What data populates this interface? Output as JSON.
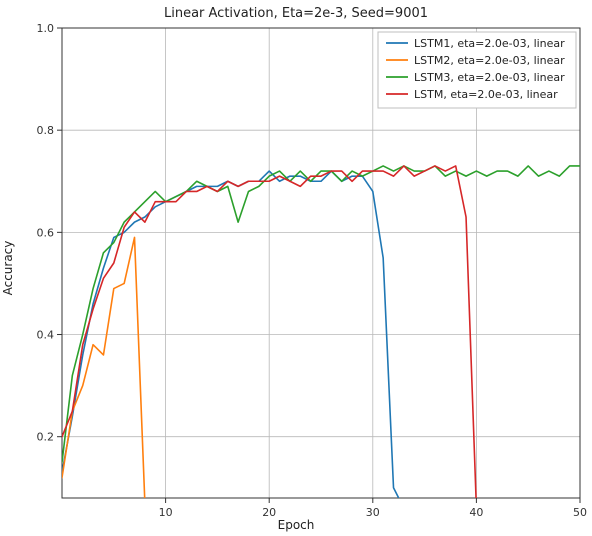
{
  "chart_data": {
    "type": "line",
    "title": "Linear Activation, Eta=2e-3, Seed=9001",
    "xlabel": "Epoch",
    "ylabel": "Accuracy",
    "xlim": [
      0,
      50
    ],
    "ylim": [
      0.08,
      1.0
    ],
    "xticks": [
      10,
      20,
      30,
      40,
      50
    ],
    "yticks": [
      0.2,
      0.4,
      0.6,
      0.8,
      1.0
    ],
    "grid": true,
    "legend_position": "upper-right",
    "x": [
      0,
      1,
      2,
      3,
      4,
      5,
      6,
      7,
      8,
      9,
      10,
      11,
      12,
      13,
      14,
      15,
      16,
      17,
      18,
      19,
      20,
      21,
      22,
      23,
      24,
      25,
      26,
      27,
      28,
      29,
      30,
      31,
      32,
      33,
      34,
      35,
      36,
      37,
      38,
      39,
      40,
      41,
      42,
      43,
      44,
      45,
      46,
      47,
      48,
      49,
      50
    ],
    "series": [
      {
        "name": "LSTM1, eta=2.0e-03, linear",
        "color": "#1f77b4",
        "values": [
          0.13,
          0.24,
          0.36,
          0.46,
          0.53,
          0.59,
          0.6,
          0.62,
          0.63,
          0.65,
          0.66,
          0.67,
          0.68,
          0.69,
          0.69,
          0.69,
          0.7,
          0.69,
          0.7,
          0.7,
          0.72,
          0.7,
          0.71,
          0.71,
          0.7,
          0.7,
          0.72,
          0.7,
          0.71,
          0.71,
          0.68,
          0.55,
          0.1,
          0.06,
          0.05,
          0.04,
          0.03,
          0.03,
          0.03,
          0.03,
          0.03,
          0.03,
          0.03,
          0.03,
          0.03,
          0.03,
          0.03,
          0.03,
          0.03,
          0.03,
          0.03
        ]
      },
      {
        "name": "LSTM2, eta=2.0e-03, linear",
        "color": "#ff7f0e",
        "values": [
          0.12,
          0.25,
          0.3,
          0.38,
          0.36,
          0.49,
          0.5,
          0.59,
          0.07,
          0.04,
          0.07,
          0.06,
          0.05,
          0.05,
          0.04,
          0.04,
          0.04,
          0.04,
          0.05,
          0.04,
          0.04,
          0.04,
          0.05,
          0.04,
          0.04,
          0.03,
          0.04,
          0.03,
          0.04,
          0.03,
          0.03,
          0.03,
          0.03,
          0.03,
          0.03,
          0.03,
          0.03,
          0.03,
          0.03,
          0.03,
          0.03,
          0.03,
          0.03,
          0.03,
          0.03,
          0.03,
          0.03,
          0.03,
          0.03,
          0.03,
          0.03
        ]
      },
      {
        "name": "LSTM3, eta=2.0e-03, linear",
        "color": "#2ca02c",
        "values": [
          0.15,
          0.32,
          0.4,
          0.49,
          0.56,
          0.58,
          0.62,
          0.64,
          0.66,
          0.68,
          0.66,
          0.67,
          0.68,
          0.7,
          0.69,
          0.68,
          0.69,
          0.62,
          0.68,
          0.69,
          0.71,
          0.72,
          0.7,
          0.72,
          0.7,
          0.72,
          0.72,
          0.7,
          0.72,
          0.71,
          0.72,
          0.73,
          0.72,
          0.73,
          0.72,
          0.72,
          0.73,
          0.71,
          0.72,
          0.71,
          0.72,
          0.71,
          0.72,
          0.72,
          0.71,
          0.73,
          0.71,
          0.72,
          0.71,
          0.73,
          0.73
        ]
      },
      {
        "name": "LSTM, eta=2.0e-03, linear",
        "color": "#d62728",
        "values": [
          0.2,
          0.25,
          0.38,
          0.45,
          0.51,
          0.54,
          0.61,
          0.64,
          0.62,
          0.66,
          0.66,
          0.66,
          0.68,
          0.68,
          0.69,
          0.68,
          0.7,
          0.69,
          0.7,
          0.7,
          0.7,
          0.71,
          0.7,
          0.69,
          0.71,
          0.71,
          0.72,
          0.72,
          0.7,
          0.72,
          0.72,
          0.72,
          0.71,
          0.73,
          0.71,
          0.72,
          0.73,
          0.72,
          0.73,
          0.63,
          0.06,
          0.04,
          0.03,
          0.03,
          0.03,
          0.03,
          0.03,
          0.03,
          0.03,
          0.03,
          0.03
        ]
      }
    ]
  }
}
